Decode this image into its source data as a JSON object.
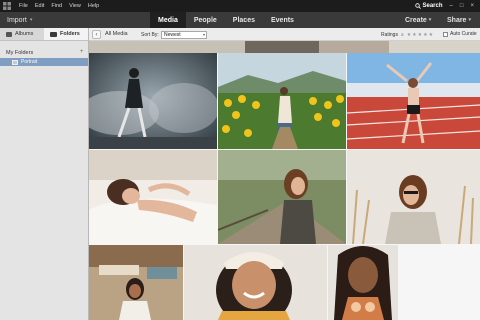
{
  "menubar": {
    "items": [
      "File",
      "Edit",
      "Find",
      "View",
      "Help"
    ],
    "search_label": "Search"
  },
  "topbar": {
    "import_label": "Import",
    "tabs": [
      "Media",
      "People",
      "Places",
      "Events"
    ],
    "active_tab": "Media",
    "create_label": "Create",
    "share_label": "Share"
  },
  "sidebar": {
    "tabs": [
      "Albums",
      "Folders"
    ],
    "active_tab": "Folders",
    "section_label": "My Folders",
    "folders": [
      {
        "label": "Portrait",
        "selected": true
      }
    ]
  },
  "toolbar": {
    "breadcrumb": "All Media",
    "sort_label": "Sort By:",
    "sort_value": "Newest",
    "ratings_label": "Ratings",
    "ratings_operator": "≥",
    "stars": "★★★★★",
    "auto_curate_label": "Auto Curate"
  },
  "colors": {
    "accent_tab": "#202020",
    "selection": "#7f9ec1"
  }
}
